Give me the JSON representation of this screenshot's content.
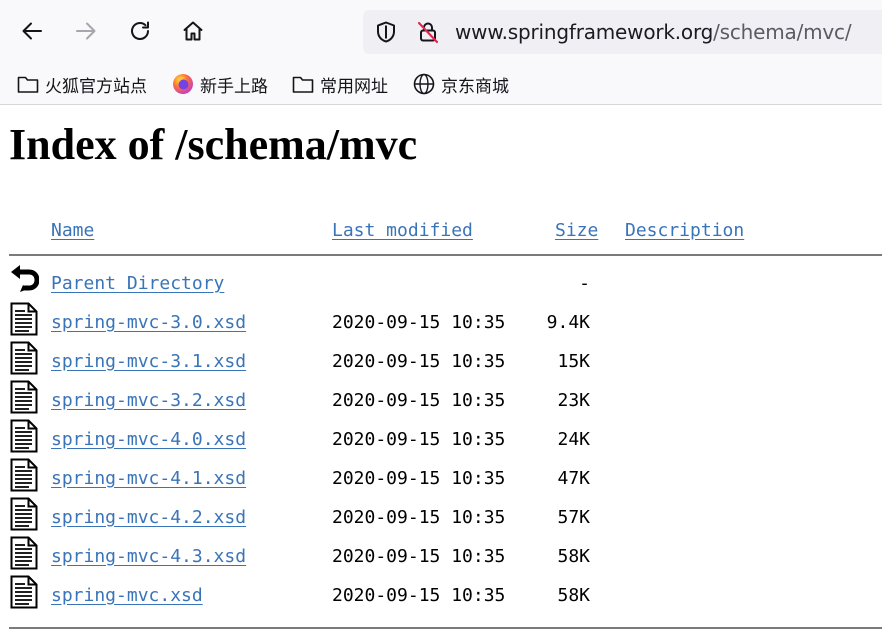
{
  "browser": {
    "url_domain": "www.springframework.org",
    "url_path": "/schema/mvc/",
    "bookmarks": [
      {
        "label": "火狐官方站点",
        "icon": "folder-icon"
      },
      {
        "label": "新手上路",
        "icon": "firefox-icon"
      },
      {
        "label": "常用网址",
        "icon": "folder-icon"
      },
      {
        "label": "京东商城",
        "icon": "globe-icon"
      }
    ]
  },
  "page": {
    "title": "Index of /schema/mvc",
    "headers": {
      "name": "Name",
      "last_modified": "Last modified",
      "size": "Size",
      "description": "Description"
    },
    "rows": [
      {
        "name": "Parent Directory",
        "date": "",
        "size": "-",
        "icon": "back-arrow-icon"
      },
      {
        "name": "spring-mvc-3.0.xsd",
        "date": "2020-09-15 10:35",
        "size": "9.4K",
        "icon": "file-icon"
      },
      {
        "name": "spring-mvc-3.1.xsd",
        "date": "2020-09-15 10:35",
        "size": "15K",
        "icon": "file-icon"
      },
      {
        "name": "spring-mvc-3.2.xsd",
        "date": "2020-09-15 10:35",
        "size": "23K",
        "icon": "file-icon"
      },
      {
        "name": "spring-mvc-4.0.xsd",
        "date": "2020-09-15 10:35",
        "size": "24K",
        "icon": "file-icon"
      },
      {
        "name": "spring-mvc-4.1.xsd",
        "date": "2020-09-15 10:35",
        "size": "47K",
        "icon": "file-icon"
      },
      {
        "name": "spring-mvc-4.2.xsd",
        "date": "2020-09-15 10:35",
        "size": "57K",
        "icon": "file-icon"
      },
      {
        "name": "spring-mvc-4.3.xsd",
        "date": "2020-09-15 10:35",
        "size": "58K",
        "icon": "file-icon"
      },
      {
        "name": "spring-mvc.xsd",
        "date": "2020-09-15 10:35",
        "size": "58K",
        "icon": "file-icon"
      }
    ]
  },
  "colors": {
    "link": "#3a74b8",
    "toolbar_bg": "#f9f9fb",
    "urlbar_bg": "#f0f0f4"
  }
}
